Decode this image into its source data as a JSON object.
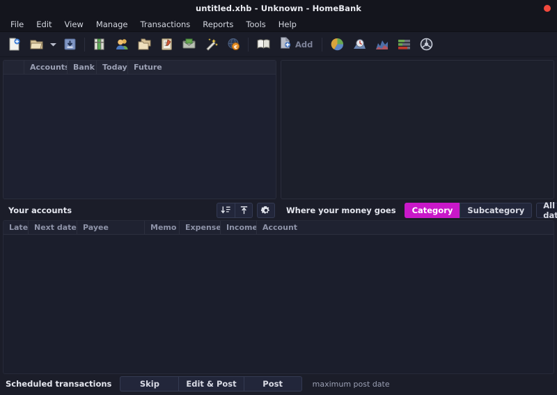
{
  "window": {
    "title": "untitled.xhb - Unknown - HomeBank",
    "close_label": "",
    "close_icon": "window-close-dot"
  },
  "menubar": {
    "items": [
      {
        "label": "File"
      },
      {
        "label": "Edit"
      },
      {
        "label": "View"
      },
      {
        "label": "Manage"
      },
      {
        "label": "Transactions"
      },
      {
        "label": "Reports"
      },
      {
        "label": "Tools"
      },
      {
        "label": "Help"
      }
    ]
  },
  "toolbar": {
    "buttons": [
      {
        "name": "new-file",
        "icon": "new-document-icon",
        "label": ""
      },
      {
        "name": "open-file",
        "icon": "open-folder-icon",
        "label": ""
      },
      {
        "name": "open-recent",
        "icon": "chevron-down-icon",
        "label": ""
      },
      {
        "name": "save-file",
        "icon": "save-disk-icon",
        "label": ""
      },
      {
        "name": "accounts",
        "icon": "accounts-books-icon",
        "label": ""
      },
      {
        "name": "payees",
        "icon": "payees-people-icon",
        "label": ""
      },
      {
        "name": "categories",
        "icon": "categories-folders-icon",
        "label": ""
      },
      {
        "name": "archives",
        "icon": "scheduled-clipboard-icon",
        "label": ""
      },
      {
        "name": "budget",
        "icon": "budget-envelope-icon",
        "label": ""
      },
      {
        "name": "assign-rules",
        "icon": "magic-wand-icon",
        "label": ""
      },
      {
        "name": "currencies",
        "icon": "currency-globe-icon",
        "label": ""
      },
      {
        "name": "show-register",
        "icon": "account-book-icon",
        "label": ""
      },
      {
        "name": "add-transaction",
        "icon": "add-transaction-icon",
        "label": "Add"
      },
      {
        "name": "report-statistics",
        "icon": "pie-chart-icon",
        "label": ""
      },
      {
        "name": "report-trend",
        "icon": "trend-time-icon",
        "label": ""
      },
      {
        "name": "report-balance",
        "icon": "balance-chart-icon",
        "label": ""
      },
      {
        "name": "report-budget",
        "icon": "budget-bars-icon",
        "label": ""
      },
      {
        "name": "report-vehicle",
        "icon": "vehicle-cost-icon",
        "label": ""
      }
    ]
  },
  "accounts_pane": {
    "columns": [
      "",
      "Accounts",
      "Bank",
      "Today",
      "Future"
    ],
    "rows": [],
    "footer": {
      "title": "Your accounts",
      "expand_all_icon": "expand-all-icon",
      "collapse_all_icon": "collapse-all-icon",
      "settings_icon": "gear-icon"
    }
  },
  "chart_pane": {
    "footer": {
      "title": "Where your money goes",
      "toggles": [
        {
          "label": "Category",
          "active": true
        },
        {
          "label": "Subcategory",
          "active": false
        }
      ],
      "range": {
        "value": "All date",
        "chevron_icon": "chevron-down-icon"
      }
    },
    "chart_data": {
      "type": "pie",
      "title": "Where your money goes",
      "categories": [],
      "values": [],
      "legend": [],
      "empty": true
    }
  },
  "scheduled_pane": {
    "columns": [
      "Late",
      "Next date",
      "Payee",
      "Memo",
      "Expense",
      "Income",
      "Account"
    ],
    "rows": [],
    "footer": {
      "title": "Scheduled transactions",
      "buttons": [
        {
          "label": "Skip"
        },
        {
          "label": "Edit & Post"
        },
        {
          "label": "Post"
        }
      ],
      "note": "maximum post date"
    }
  }
}
